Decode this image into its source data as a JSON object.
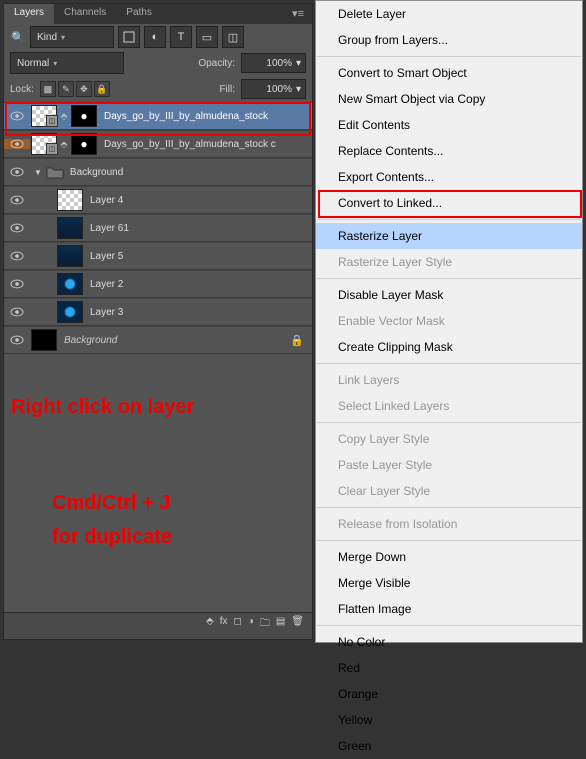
{
  "tabs": {
    "t1": "Layers",
    "t2": "Channels",
    "t3": "Paths"
  },
  "filter": {
    "kind": "Kind",
    "opacity_label": "Opacity:",
    "opacity_val": "100%",
    "blend": "Normal",
    "lock_label": "Lock:",
    "fill_label": "Fill:",
    "fill_val": "100%"
  },
  "layers": [
    {
      "id": "l0",
      "name": "Days_go_by_III_by_almudena_stock",
      "smart": true,
      "mask": true,
      "selected": true
    },
    {
      "id": "l1",
      "name": "Days_go_by_III_by_almudena_stock c",
      "smart": true,
      "mask": true,
      "label": "orange"
    },
    {
      "id": "g0",
      "name": "Background",
      "group": true
    },
    {
      "id": "l2",
      "name": "Layer 4",
      "thumb": "checker",
      "indent": 1
    },
    {
      "id": "l3",
      "name": "Layer 61",
      "thumb": "blue",
      "indent": 1
    },
    {
      "id": "l4",
      "name": "Layer 5",
      "thumb": "blue",
      "indent": 1
    },
    {
      "id": "l5",
      "name": "Layer 2",
      "thumb": "bluedot",
      "indent": 1
    },
    {
      "id": "l6",
      "name": "Layer 3",
      "thumb": "bluedot",
      "indent": 1
    },
    {
      "id": "l7",
      "name": "Background",
      "thumb": "dark",
      "italic": true,
      "locked": true
    }
  ],
  "ctx": [
    {
      "t": "Delete Layer"
    },
    {
      "t": "Group from Layers..."
    },
    {
      "sep": true
    },
    {
      "t": "Convert to Smart Object"
    },
    {
      "t": "New Smart Object via Copy"
    },
    {
      "t": "Edit Contents"
    },
    {
      "t": "Replace Contents..."
    },
    {
      "t": "Export Contents..."
    },
    {
      "t": "Convert to Linked..."
    },
    {
      "sep": true
    },
    {
      "t": "Rasterize Layer",
      "hl": true
    },
    {
      "t": "Rasterize Layer Style",
      "d": true
    },
    {
      "sep": true
    },
    {
      "t": "Disable Layer Mask"
    },
    {
      "t": "Enable Vector Mask",
      "d": true
    },
    {
      "t": "Create Clipping Mask"
    },
    {
      "sep": true
    },
    {
      "t": "Link Layers",
      "d": true
    },
    {
      "t": "Select Linked Layers",
      "d": true
    },
    {
      "sep": true
    },
    {
      "t": "Copy Layer Style",
      "d": true
    },
    {
      "t": "Paste Layer Style",
      "d": true
    },
    {
      "t": "Clear Layer Style",
      "d": true
    },
    {
      "sep": true
    },
    {
      "t": "Release from Isolation",
      "d": true
    },
    {
      "sep": true
    },
    {
      "t": "Merge Down"
    },
    {
      "t": "Merge Visible"
    },
    {
      "t": "Flatten Image"
    },
    {
      "sep": true
    },
    {
      "t": "No Color"
    },
    {
      "t": "Red"
    },
    {
      "t": "Orange"
    },
    {
      "t": "Yellow"
    },
    {
      "t": "Green"
    }
  ],
  "anno1": "Right click on layer",
  "anno2a": "Cmd/Ctrl + J",
  "anno2b": "for duplicate"
}
